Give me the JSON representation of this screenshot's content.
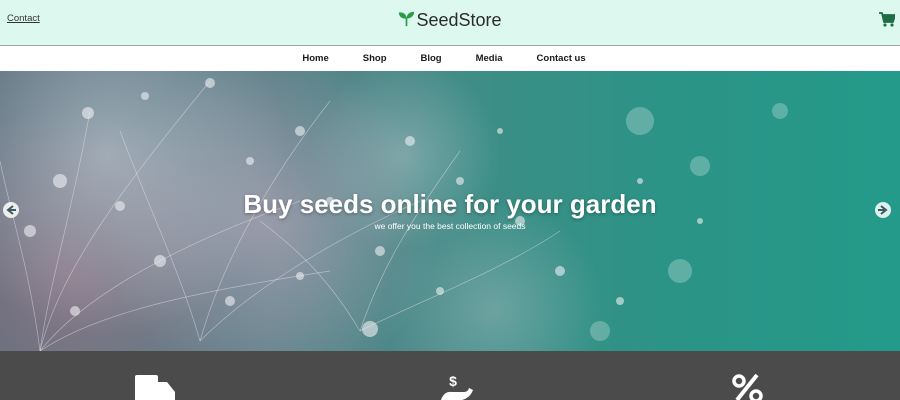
{
  "header": {
    "contact_link": "Contact",
    "brand_name": "SeedStore",
    "brand_icon": "sprout-icon",
    "cart_icon": "cart-icon"
  },
  "nav": {
    "items": [
      {
        "label": "Home"
      },
      {
        "label": "Shop"
      },
      {
        "label": "Blog"
      },
      {
        "label": "Media"
      },
      {
        "label": "Contact us"
      }
    ]
  },
  "hero": {
    "title": "Buy seeds online for your garden",
    "subtitle": "we offer you the best collection of seeds",
    "prev_icon": "arrow-left-circle-icon",
    "next_icon": "arrow-right-circle-icon"
  },
  "features": {
    "icons": [
      "truck-icon",
      "dollar-hand-icon",
      "percent-icon"
    ]
  },
  "colors": {
    "header_bg": "#dcf8ef",
    "brand_green": "#2e9b4a",
    "cart_green": "#1f6e45",
    "hero_teal": "#2b9486",
    "features_bg": "#4b4b4b"
  }
}
